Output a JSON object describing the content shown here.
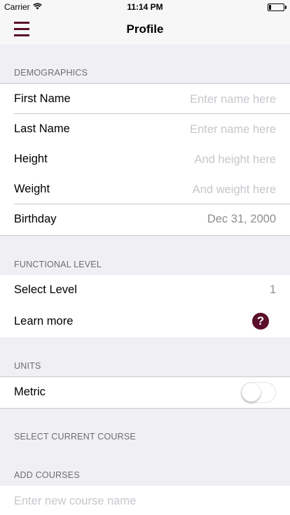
{
  "status_bar": {
    "carrier": "Carrier",
    "wifi_icon": "wifi-icon",
    "time": "11:14 PM",
    "battery_icon": "battery-icon"
  },
  "nav": {
    "menu_icon": "hamburger-menu-icon",
    "title": "Profile"
  },
  "demographics": {
    "header": "DEMOGRAPHICS",
    "first_name": {
      "label": "First Name",
      "value": "",
      "placeholder": "Enter name here"
    },
    "last_name": {
      "label": "Last Name",
      "value": "",
      "placeholder": "Enter name here"
    },
    "height": {
      "label": "Height",
      "value": "",
      "placeholder": "And height here"
    },
    "weight": {
      "label": "Weight",
      "value": "",
      "placeholder": "And weight here"
    },
    "birthday": {
      "label": "Birthday",
      "value": "Dec 31, 2000"
    }
  },
  "functional_level": {
    "header": "FUNCTIONAL LEVEL",
    "select_level": {
      "label": "Select Level",
      "value": "1"
    },
    "learn_more": {
      "label": "Learn more",
      "help_glyph": "?",
      "icon": "question-circle-icon"
    }
  },
  "units": {
    "header": "UNITS",
    "metric": {
      "label": "Metric",
      "enabled": false
    }
  },
  "courses": {
    "select_header": "SELECT CURRENT COURSE",
    "add_header": "ADD COURSES",
    "new_course": {
      "value": "",
      "placeholder": "Enter new course name"
    }
  },
  "colors": {
    "accent": "#5a0f2a",
    "background": "#efeff4",
    "separator": "#c8c7cc",
    "placeholder": "#c7c7cd",
    "secondary_text": "#6d6d72"
  }
}
